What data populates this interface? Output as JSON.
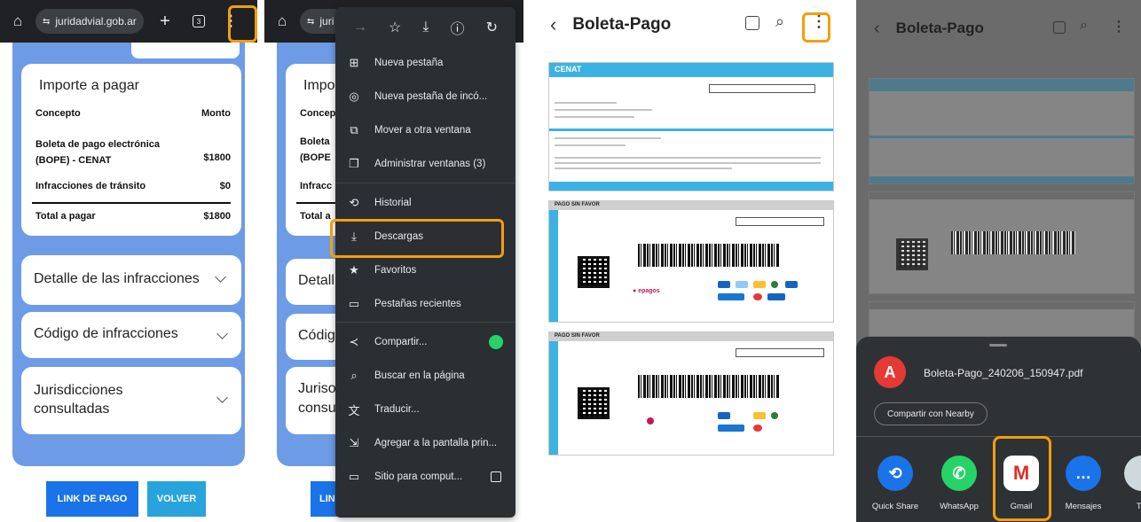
{
  "panel1": {
    "browser": {
      "url": "juridadvial.gob.ar",
      "tab_icon": "tabs-icon",
      "plus": "+",
      "menu": "⋮"
    },
    "card": {
      "title": "Importe a pagar",
      "col_concept": "Concepto",
      "col_amount": "Monto",
      "rows": [
        {
          "concept": "Boleta de pago electrónica (BOPE) - CENAT",
          "amount": "$1800"
        },
        {
          "concept": "Infracciones de tránsito",
          "amount": "$0"
        }
      ],
      "total_label": "Total a pagar",
      "total_amount": "$1800"
    },
    "accordions": [
      {
        "label": "Detalle de las infracciones"
      },
      {
        "label": "Código de infracciones"
      },
      {
        "label": "Jurisdicciones consultadas"
      }
    ],
    "buttons": {
      "pay": "LINK DE PAGO",
      "back": "VOLVER"
    }
  },
  "panel2": {
    "behind": {
      "url_short": "juri",
      "title_short": "Impo",
      "concept_short": "Concep",
      "row1_a": "Boleta",
      "row1_b": "(BOPE",
      "row2": "Infracc",
      "total": "Total a",
      "acc1": "Detall",
      "acc2": "Códig",
      "acc3_a": "Juriso",
      "acc3_b": "consu",
      "btn": "LIN"
    },
    "menu_items": [
      {
        "icon": "⊞",
        "label": "Nueva pestaña"
      },
      {
        "icon": "◎",
        "label": "Nueva pestaña de incó..."
      },
      {
        "icon": "⧉",
        "label": "Mover a otra ventana"
      },
      {
        "icon": "❐",
        "label": "Administrar ventanas (3)"
      },
      {
        "icon": "⟲",
        "label": "Historial"
      },
      {
        "icon": "⤓",
        "label": "Descargas"
      },
      {
        "icon": "★",
        "label": "Favoritos"
      },
      {
        "icon": "▭",
        "label": "Pestañas recientes"
      },
      {
        "icon": "≺",
        "label": "Compartir..."
      },
      {
        "icon": "⌕",
        "label": "Buscar en la página"
      },
      {
        "icon": "文",
        "label": "Traducir..."
      },
      {
        "icon": "⇲",
        "label": "Agregar a la pantalla prin..."
      },
      {
        "icon": "▭",
        "label": "Sitio para comput..."
      }
    ]
  },
  "panel3": {
    "title": "Boleta-Pago",
    "doc_header": "CENAT",
    "section1": "PAGO SIN FAVOR",
    "section2": "PAGO SIN FAVOR",
    "epagos": "epagos"
  },
  "panel4": {
    "title": "Boleta-Pago",
    "file_name": "Boleta-Pago_240206_150947.pdf",
    "nearby_label": "Compartir con Nearby",
    "apps": [
      {
        "label": "Quick Share",
        "color": "#1a73e8"
      },
      {
        "label": "WhatsApp",
        "color": "#25d366"
      },
      {
        "label": "Gmail",
        "color": "#ffffff"
      },
      {
        "label": "Mensajes",
        "color": "#1a73e8"
      },
      {
        "label": "TP",
        "color": "#cfd8dc"
      }
    ]
  },
  "colors": {
    "highlight": "#f59e0b",
    "page_blue": "#6d9be6",
    "button_blue": "#1a73e8",
    "button_lightblue": "#29a3dc",
    "doc_cyan": "#3cb2e4"
  }
}
